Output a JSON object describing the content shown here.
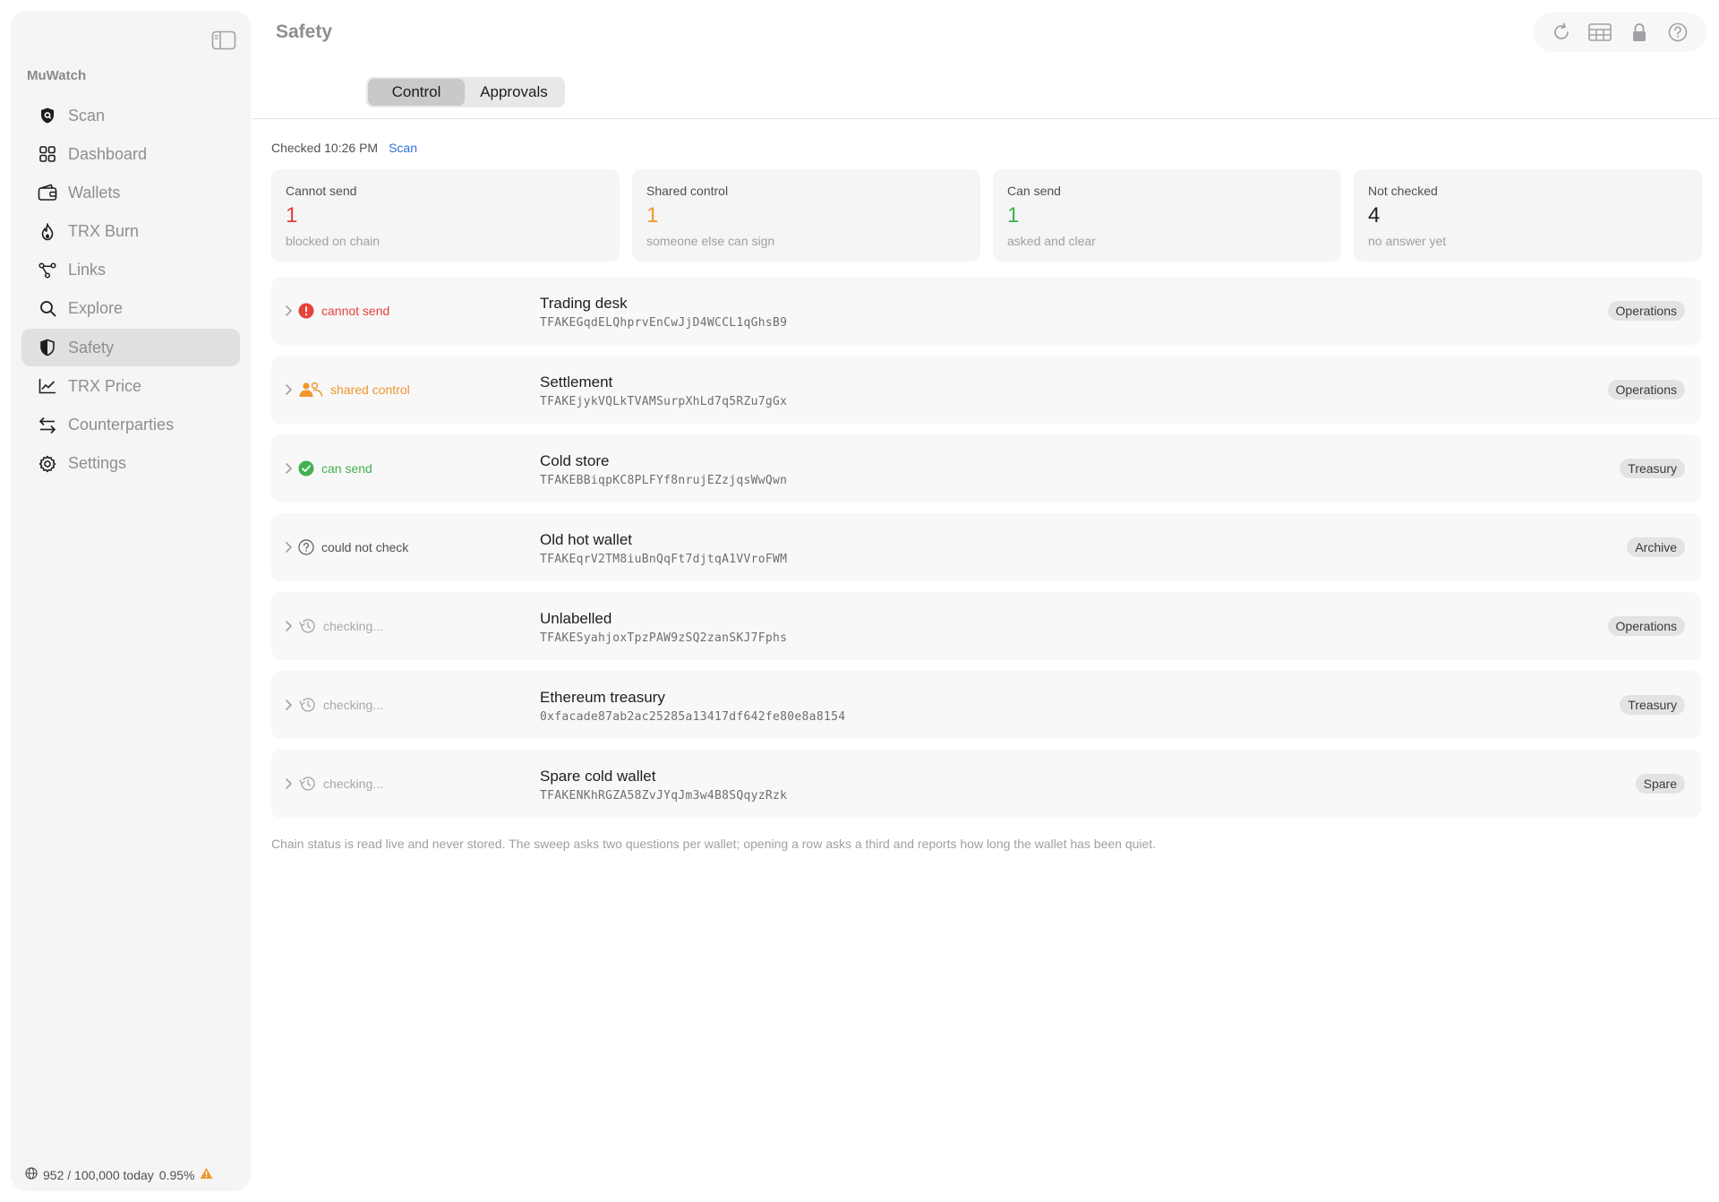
{
  "sidebar": {
    "app_name": "MuWatch",
    "items": [
      {
        "label": "Scan",
        "icon": "shield-scan-icon"
      },
      {
        "label": "Dashboard",
        "icon": "grid-icon"
      },
      {
        "label": "Wallets",
        "icon": "wallet-icon"
      },
      {
        "label": "TRX Burn",
        "icon": "flame-icon"
      },
      {
        "label": "Links",
        "icon": "network-icon"
      },
      {
        "label": "Explore",
        "icon": "search-icon"
      },
      {
        "label": "Safety",
        "icon": "shield-half-icon"
      },
      {
        "label": "TRX Price",
        "icon": "chart-line-icon"
      },
      {
        "label": "Counterparties",
        "icon": "arrows-swap-icon"
      },
      {
        "label": "Settings",
        "icon": "gear-icon"
      }
    ],
    "active_item": "Safety",
    "usage": {
      "text": "952 / 100,000 today",
      "percent": "0.95%"
    }
  },
  "header": {
    "title": "Safety"
  },
  "tabs": [
    {
      "label": "Control"
    },
    {
      "label": "Approvals"
    }
  ],
  "checked": {
    "text": "Checked 10:26 PM",
    "scan_label": "Scan"
  },
  "stats": [
    {
      "label": "Cannot send",
      "value": "1",
      "sub": "blocked on chain",
      "color": "#e5423b"
    },
    {
      "label": "Shared control",
      "value": "1",
      "sub": "someone else can sign",
      "color": "#f0962e"
    },
    {
      "label": "Can send",
      "value": "1",
      "sub": "asked and clear",
      "color": "#3fb24f"
    },
    {
      "label": "Not checked",
      "value": "4",
      "sub": "no answer yet",
      "color": "#1d1d1f"
    }
  ],
  "wallets": [
    {
      "status": "cannot send",
      "status_color": "#e5423b",
      "status_icon": "alert-circle-icon",
      "name": "Trading desk",
      "address": "TFAKEGqdELQhprvEnCwJjD4WCCL1qGhsB9",
      "tag": "Operations"
    },
    {
      "status": "shared control",
      "status_color": "#f0962e",
      "status_icon": "users-icon",
      "name": "Settlement",
      "address": "TFAKEjykVQLkTVAMSurpXhLd7q5RZu7gGx",
      "tag": "Operations"
    },
    {
      "status": "can send",
      "status_color": "#3fb24f",
      "status_icon": "check-circle-icon",
      "name": "Cold store",
      "address": "TFAKEBBiqpKC8PLFYf8nrujEZzjqsWwQwn",
      "tag": "Treasury"
    },
    {
      "status": "could not check",
      "status_color": "#505055",
      "status_icon": "question-circle-icon",
      "name": "Old hot wallet",
      "address": "TFAKEqrV2TM8iuBnQqFt7djtqA1VVroFWM",
      "tag": "Archive"
    },
    {
      "status": "checking...",
      "status_color": "#a8a8ad",
      "status_icon": "history-icon",
      "name": "Unlabelled",
      "address": "TFAKESyahjoxTpzPAW9zSQ2zanSKJ7Fphs",
      "tag": "Operations"
    },
    {
      "status": "checking...",
      "status_color": "#a8a8ad",
      "status_icon": "history-icon",
      "name": "Ethereum treasury",
      "address": "0xfacade87ab2ac25285a13417df642fe80e8a8154",
      "tag": "Treasury"
    },
    {
      "status": "checking...",
      "status_color": "#a8a8ad",
      "status_icon": "history-icon",
      "name": "Spare cold wallet",
      "address": "TFAKENKhRGZA58ZvJYqJm3w4B8SQqyzRzk",
      "tag": "Spare"
    }
  ],
  "footnote": "Chain status is read live and never stored. The sweep asks two questions per wallet; opening a row asks a third and reports how long the wallet has been quiet."
}
